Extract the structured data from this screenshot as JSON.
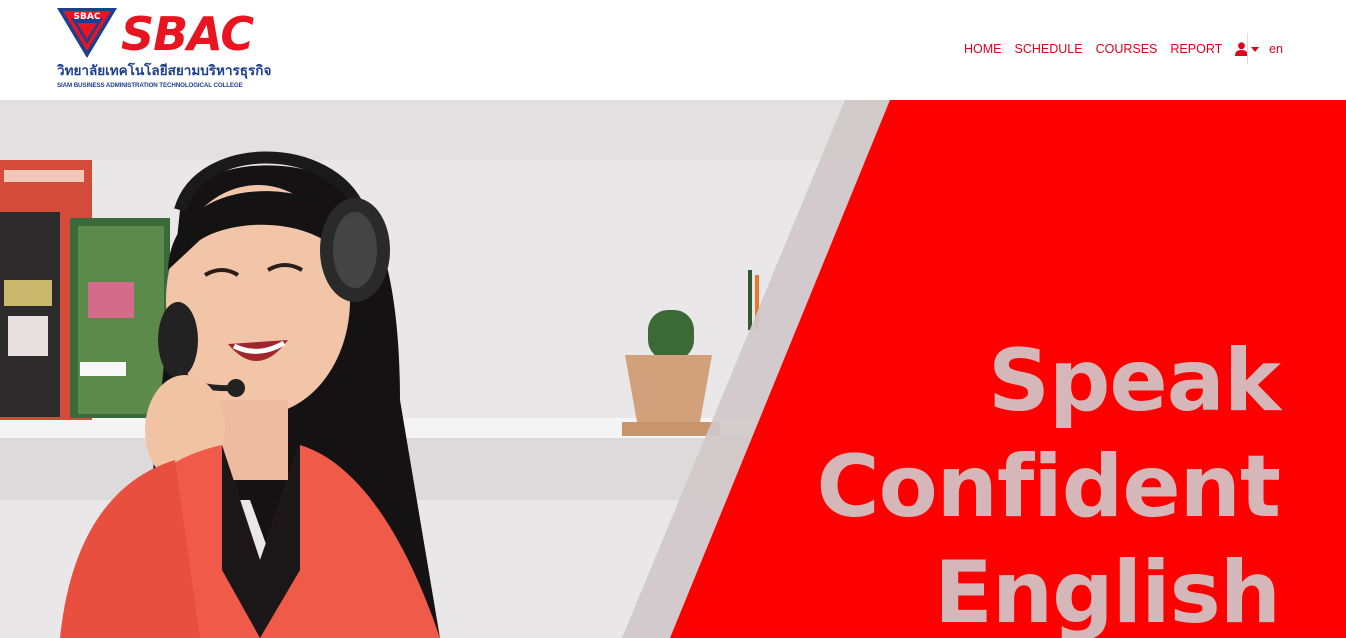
{
  "brand": {
    "logo_word": "SBAC",
    "logo_mark_text": "SBAC",
    "thai_name": "วิทยาลัยเทคโนโลยีสยามบริหารธุรกิจ",
    "english_name": "SIAM BUSINESS ADMINISTRATION TECHNOLOGICAL COLLEGE"
  },
  "nav": {
    "items": [
      {
        "label": "HOME"
      },
      {
        "label": "SCHEDULE"
      },
      {
        "label": "COURSES"
      },
      {
        "label": "REPORT"
      }
    ],
    "user_icon": "user-icon",
    "language": "en"
  },
  "hero": {
    "headline_lines": [
      "Speak",
      "Confident",
      "English"
    ],
    "image_description_icon": "student-with-headset-photo"
  },
  "colors": {
    "brand_red": "#e3001b",
    "hero_red": "#ff0000",
    "headline": "#d5b7b9",
    "brand_blue": "#1d3f8f"
  }
}
